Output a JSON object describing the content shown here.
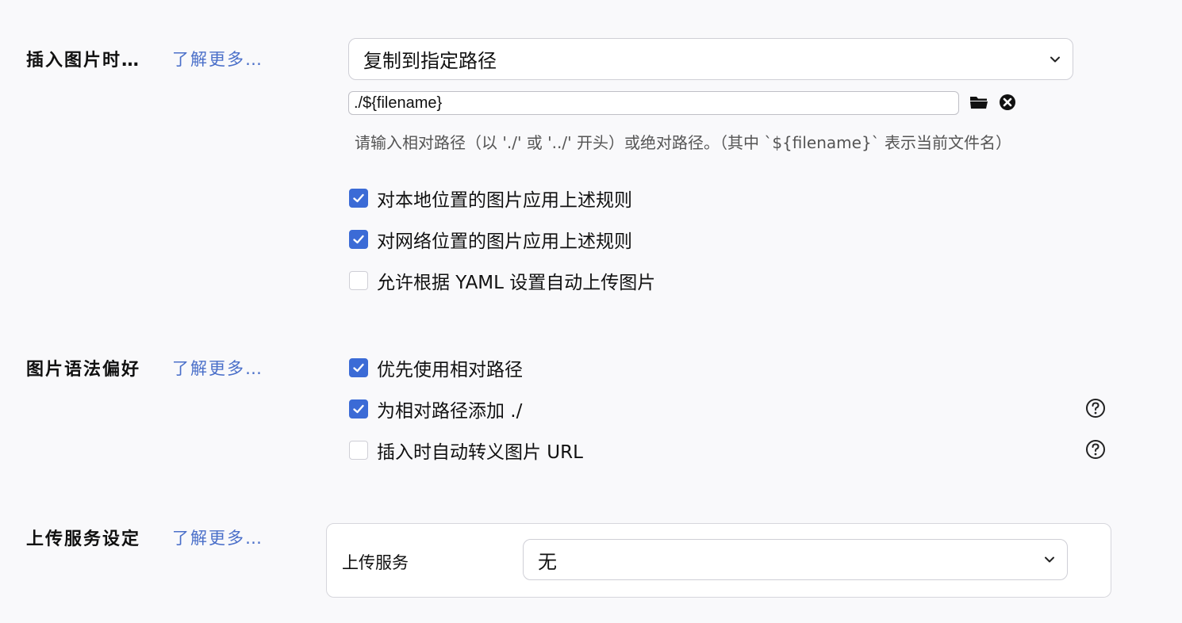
{
  "sections": {
    "insert_image": {
      "title": "插入图片时…",
      "learn_more": "了解更多…",
      "action_select": {
        "value": "复制到指定路径"
      },
      "path_input": {
        "value": "./${filename}"
      },
      "hint": "请输入相对路径（以 './' 或 '../' 开头）或绝对路径。（其中 `${filename}` 表示当前文件名）",
      "options": [
        {
          "label": "对本地位置的图片应用上述规则",
          "checked": true
        },
        {
          "label": "对网络位置的图片应用上述规则",
          "checked": true
        },
        {
          "label": "允许根据 YAML 设置自动上传图片",
          "checked": false
        }
      ]
    },
    "syntax": {
      "title": "图片语法偏好",
      "learn_more": "了解更多…",
      "options": [
        {
          "label": "优先使用相对路径",
          "checked": true
        },
        {
          "label": "为相对路径添加 ./",
          "checked": true
        },
        {
          "label": "插入时自动转义图片 URL",
          "checked": false
        }
      ]
    },
    "upload": {
      "title": "上传服务设定",
      "learn_more": "了解更多…",
      "service_label": "上传服务",
      "service_select": {
        "value": "无"
      }
    }
  },
  "icons": {
    "folder": "folder-icon",
    "clear": "clear-icon",
    "help": "help-icon",
    "chevron": "chevron-down-icon",
    "check": "check-icon"
  },
  "colors": {
    "accent": "#3b6bd6",
    "link": "#4a6fc9",
    "background": "#f9f9fb"
  }
}
